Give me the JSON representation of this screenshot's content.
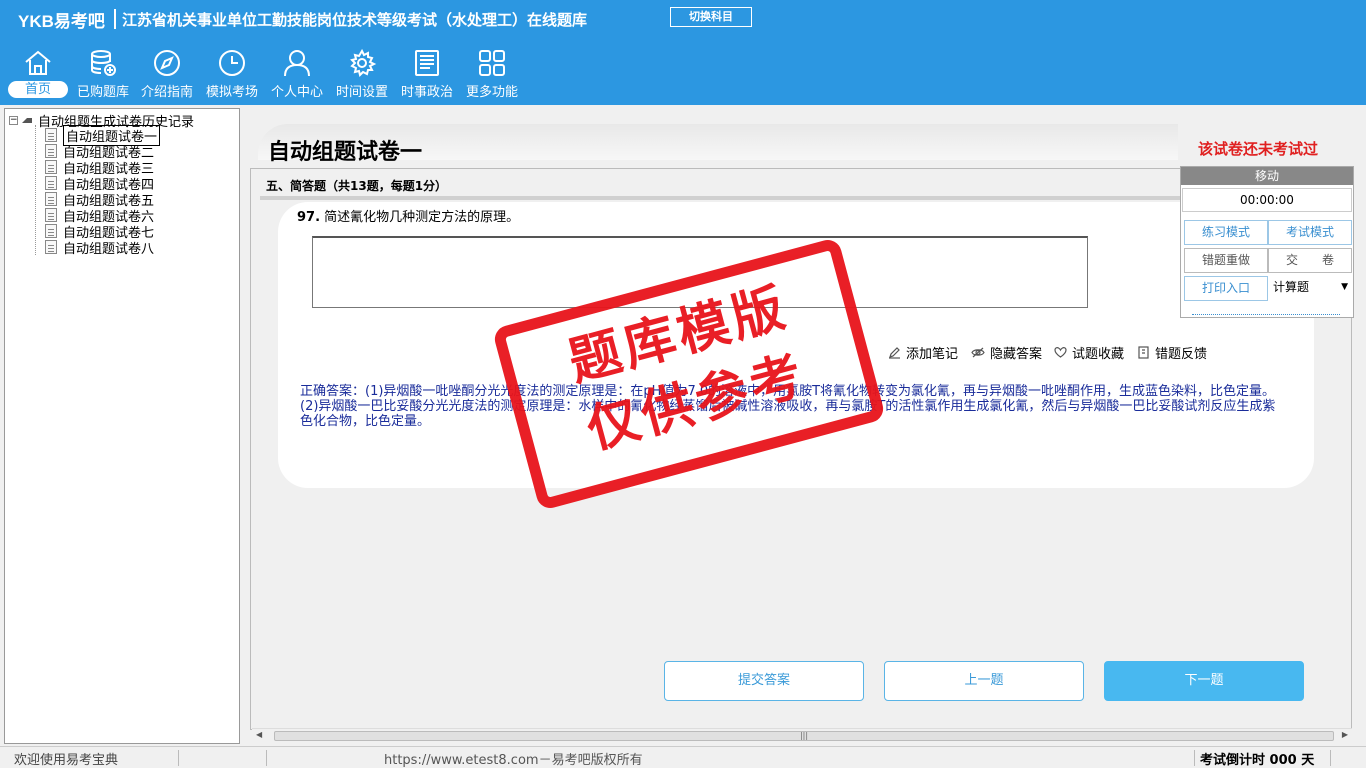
{
  "header": {
    "logo": "YKB易考吧",
    "title": "江苏省机关事业单位工勤技能岗位技术等级考试（水处理工）在线题库",
    "switch_subject": "切换科目"
  },
  "nav": [
    {
      "label": "首页",
      "icon": "home-icon"
    },
    {
      "label": "已购题库",
      "icon": "database-icon"
    },
    {
      "label": "介绍指南",
      "icon": "compass-icon"
    },
    {
      "label": "模拟考场",
      "icon": "clock-icon"
    },
    {
      "label": "个人中心",
      "icon": "user-icon"
    },
    {
      "label": "时间设置",
      "icon": "gear-icon"
    },
    {
      "label": "时事政治",
      "icon": "news-icon"
    },
    {
      "label": "更多功能",
      "icon": "grid-icon"
    }
  ],
  "tree": {
    "root": "自动组题生成试卷历史记录",
    "items": [
      "自动组题试卷一",
      "自动组题试卷二",
      "自动组题试卷三",
      "自动组题试卷四",
      "自动组题试卷五",
      "自动组题试卷六",
      "自动组题试卷七",
      "自动组题试卷八"
    ],
    "selected_index": 0
  },
  "paper": {
    "title": "自动组题试卷一",
    "status": "该试卷还未考试过",
    "section": "五、简答题（共13题，每题1分）"
  },
  "question": {
    "number": "97.",
    "text": "简述氰化物几种测定方法的原理。",
    "actions": [
      "添加笔记",
      "隐藏答案",
      "试题收藏",
      "错题反馈"
    ],
    "answer": "正确答案：(1)异烟酸一吡唑酮分光光度法的测定原理是：在pH值为7.0的溶液中，用氯胺T将氰化物转变为氯化氰，再与异烟酸一吡唑酮作用，生成蓝色染料，比色定量。(2)异烟酸一巴比妥酸分光光度法的测定原理是：水样中的氰化物经蒸馏后被碱性溶液吸收，再与氯胺T的活性氯作用生成氯化氰，然后与异烟酸一巴比妥酸试剂反应生成紫色化合物，比色定量。"
  },
  "buttons": {
    "submit": "提交答案",
    "prev": "上一题",
    "next": "下一题"
  },
  "side": {
    "move": "移动",
    "timer": "00:00:00",
    "practice": "练习模式",
    "exam": "考试模式",
    "redo": "错题重做",
    "hand_in": "交　　卷",
    "print": "打印入口",
    "qtype": "计算题"
  },
  "stamp": {
    "line1": "题库模版",
    "line2": "仅供参考"
  },
  "status": {
    "welcome": "欢迎使用易考宝典",
    "url": "https://www.etest8.com－易考吧版权所有",
    "countdown": "考试倒计时 000 天"
  }
}
